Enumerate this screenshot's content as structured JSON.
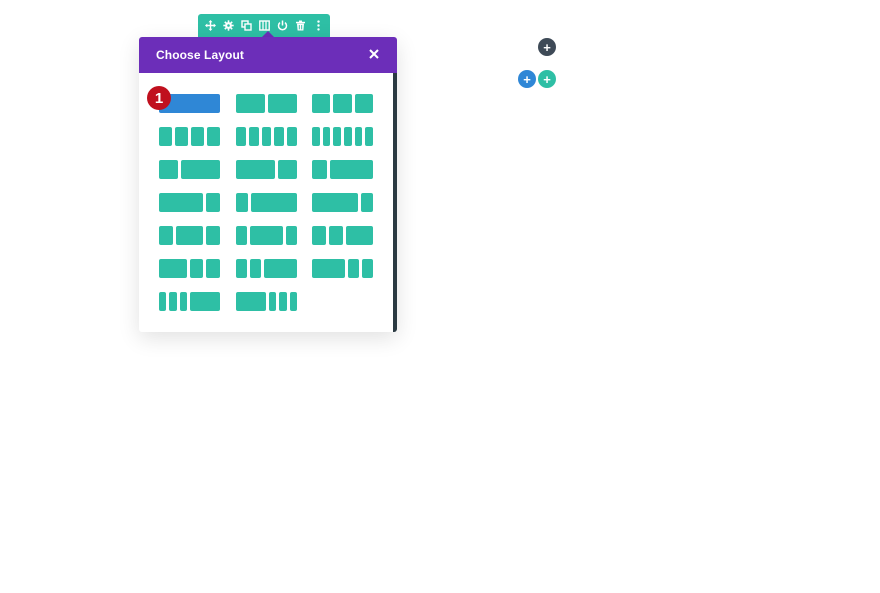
{
  "toolbar": {
    "icons": [
      "move-icon",
      "gear-icon",
      "duplicate-icon",
      "columns-icon",
      "power-icon",
      "trash-icon",
      "more-icon"
    ],
    "color": "#2ebfa5"
  },
  "modal": {
    "title": "Choose Layout",
    "close_glyph": "×",
    "header_color": "#6c2eb9",
    "selected_index": 0,
    "layouts": [
      {
        "cols": [
          1
        ]
      },
      {
        "cols": [
          1,
          1
        ]
      },
      {
        "cols": [
          1,
          1,
          1
        ]
      },
      {
        "cols": [
          1,
          1,
          1,
          1
        ]
      },
      {
        "cols": [
          1,
          1,
          1,
          1,
          1
        ]
      },
      {
        "cols": [
          1,
          1,
          1,
          1,
          1,
          1
        ]
      },
      {
        "cols": [
          1,
          2
        ]
      },
      {
        "cols": [
          2,
          1
        ]
      },
      {
        "cols": [
          1,
          3
        ]
      },
      {
        "cols": [
          3,
          1
        ]
      },
      {
        "cols": [
          1,
          4
        ]
      },
      {
        "cols": [
          4,
          1
        ]
      },
      {
        "cols": [
          1,
          2,
          1
        ]
      },
      {
        "cols": [
          1,
          3,
          1
        ]
      },
      {
        "cols": [
          1,
          1,
          2
        ]
      },
      {
        "cols": [
          2,
          1,
          1
        ]
      },
      {
        "cols": [
          1,
          1,
          3
        ]
      },
      {
        "cols": [
          3,
          1,
          1
        ]
      },
      {
        "cols": [
          1,
          1,
          1,
          4
        ]
      },
      {
        "cols": [
          4,
          1,
          1,
          1
        ]
      }
    ]
  },
  "step_badge": "1",
  "buttons": {
    "add_section": "+",
    "add_row_blue": "+",
    "add_row_teal": "+"
  }
}
